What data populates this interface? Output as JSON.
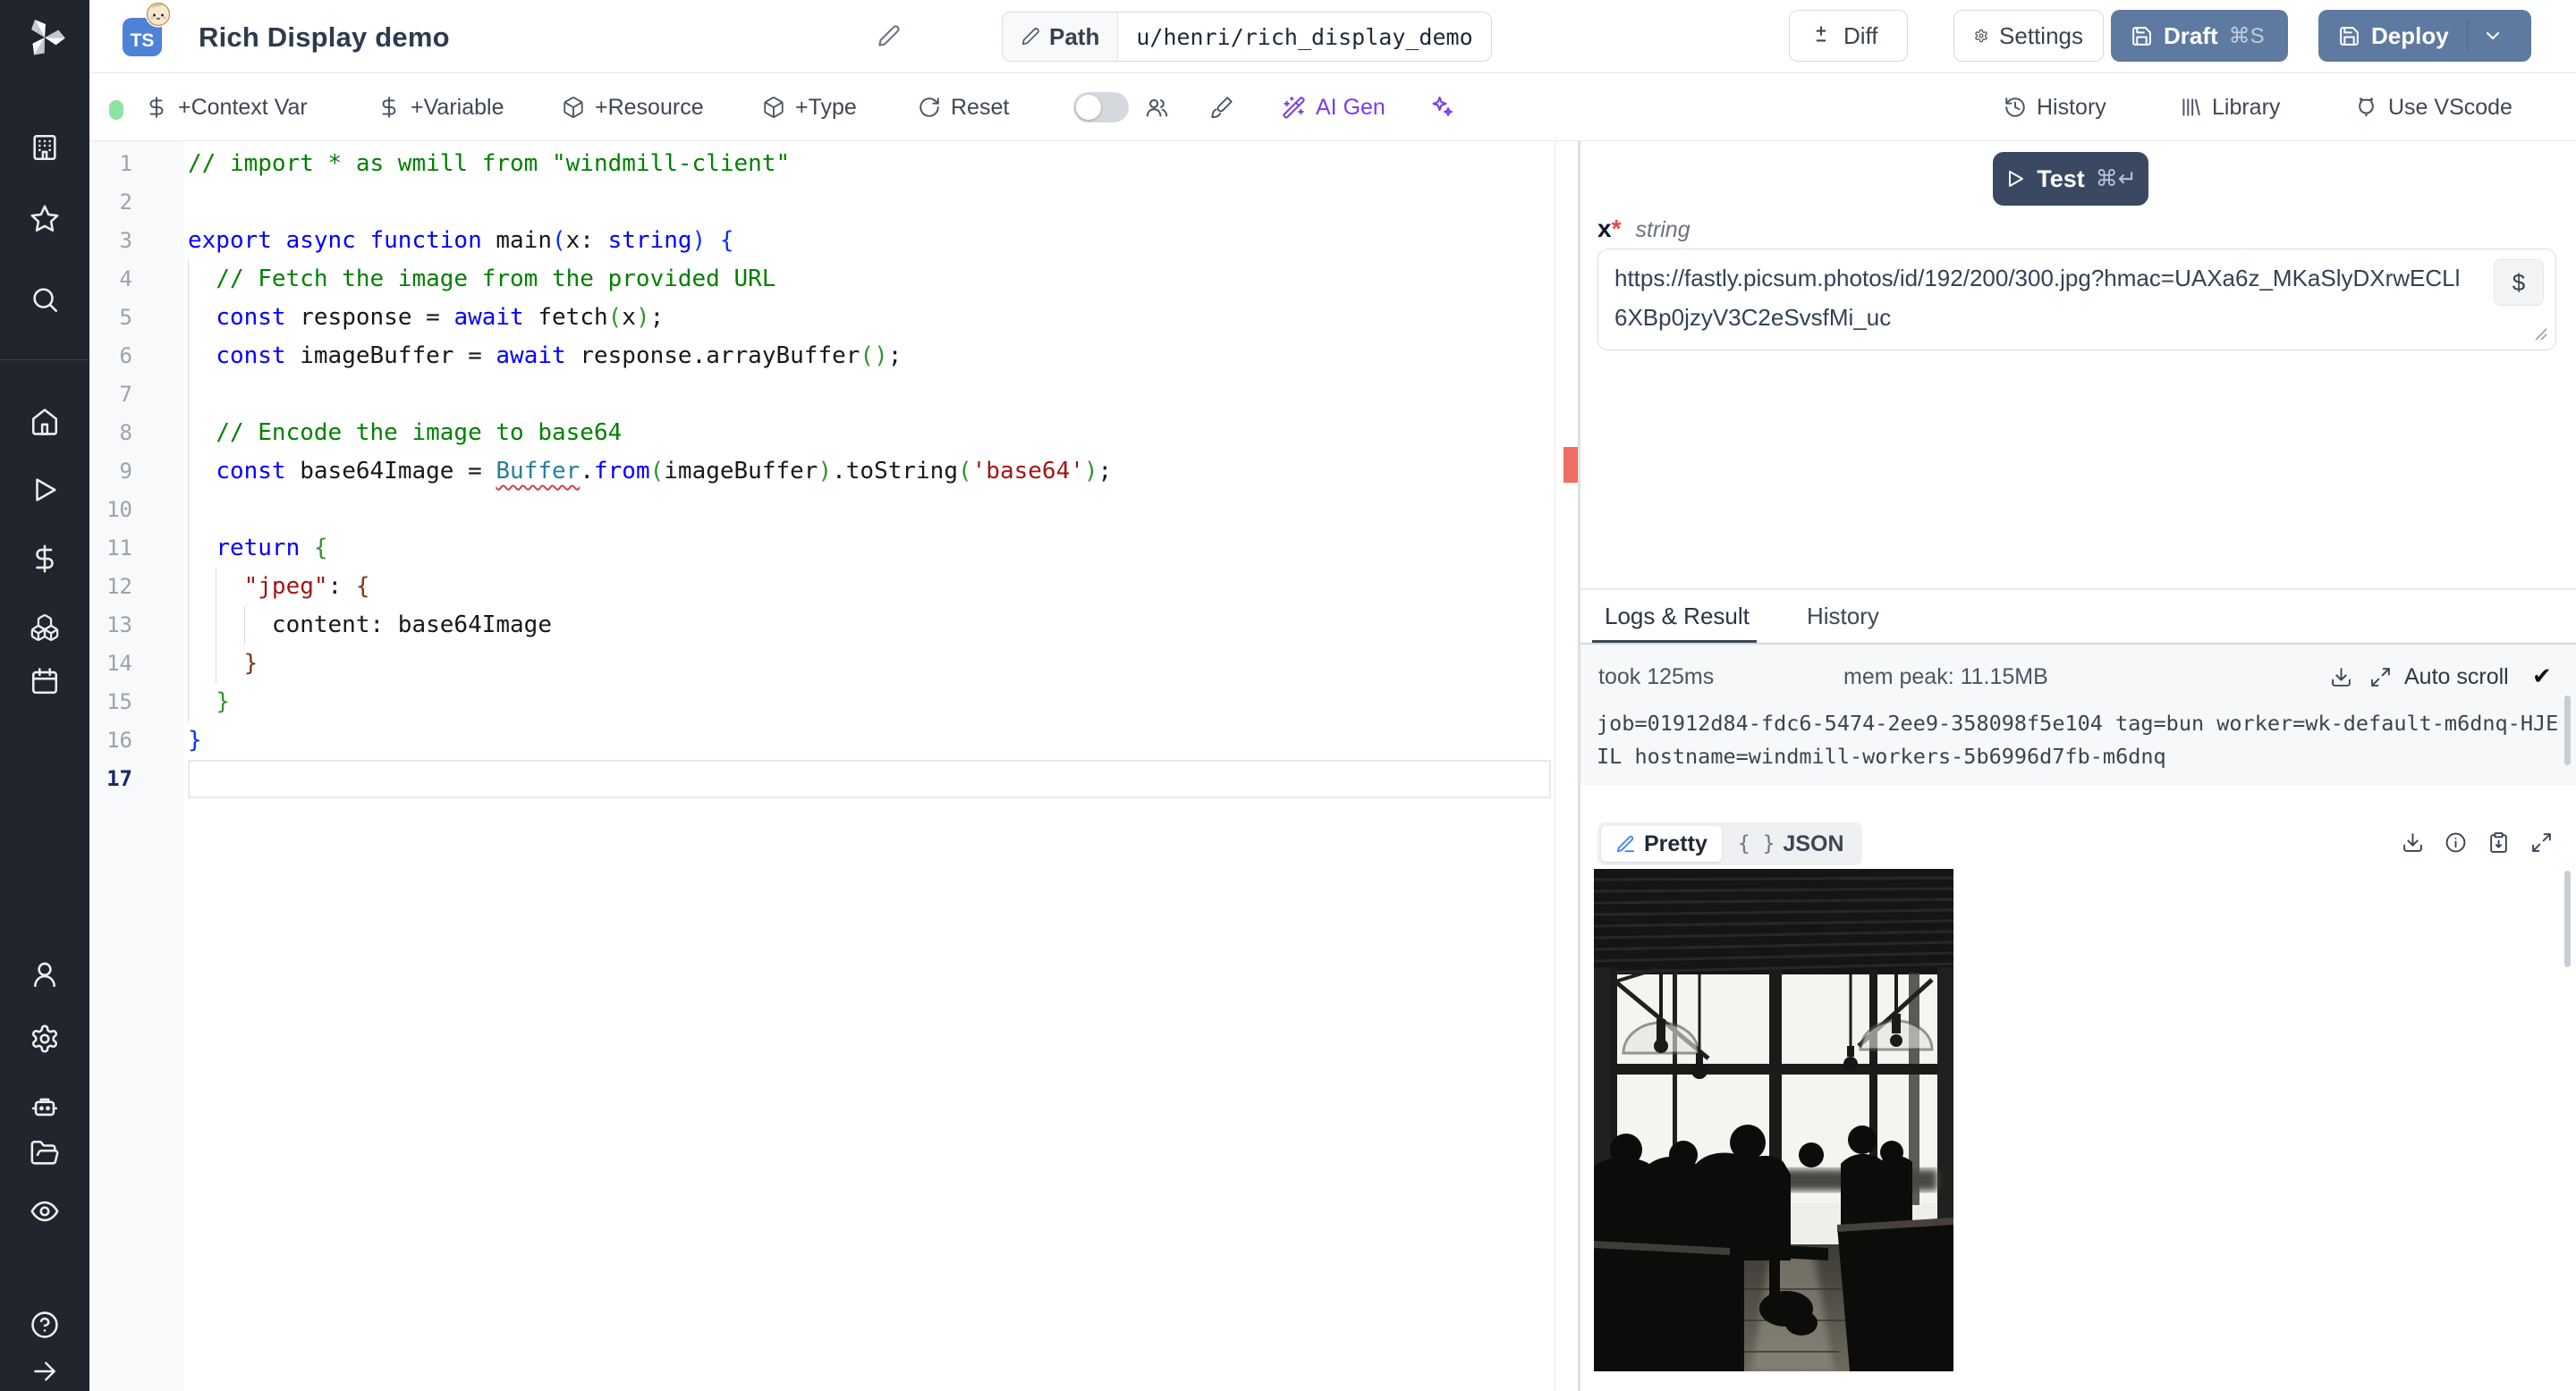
{
  "app": {
    "name": "Windmill"
  },
  "header": {
    "language_badge": "TS",
    "title": "Rich Display demo",
    "path_label": "Path",
    "path_value": "u/henri/rich_display_demo",
    "diff_label": "Diff",
    "settings_label": "Settings",
    "draft_label": "Draft",
    "draft_shortcut": "⌘S",
    "deploy_label": "Deploy"
  },
  "toolbar": {
    "context_var": "+Context Var",
    "variable": "+Variable",
    "resource": "+Resource",
    "type": "+Type",
    "reset": "Reset",
    "ai_gen": "AI Gen",
    "history": "History",
    "library": "Library",
    "vscode": "Use VScode",
    "accent_purple": "#7c3aed",
    "status_green": "#8fe3a2"
  },
  "sidebar": {
    "icons": [
      "windmill-logo",
      "workspace",
      "favorites",
      "search",
      "home",
      "runs",
      "variables",
      "resources",
      "schedules",
      "user",
      "settings",
      "workers",
      "folders",
      "audit-logs",
      "help",
      "expand"
    ]
  },
  "editor": {
    "active_line": 17,
    "error_line": 9,
    "colors": {
      "comment": "#008000",
      "keyword": "#0000ff",
      "type": "#267f99",
      "string": "#a31515"
    },
    "lines": [
      {
        "n": 1,
        "g": [],
        "seg": [
          [
            "c",
            "// import * as wmill from \"windmill-client\""
          ]
        ]
      },
      {
        "n": 2,
        "g": [],
        "seg": []
      },
      {
        "n": 3,
        "g": [],
        "seg": [
          [
            "k",
            "export async function "
          ],
          [
            "p",
            "main"
          ],
          [
            "b1",
            "("
          ],
          [
            "p",
            "x: "
          ],
          [
            "k",
            "string"
          ],
          [
            "b1",
            ")"
          ],
          [
            "p",
            " "
          ],
          [
            "b1",
            "{"
          ]
        ]
      },
      {
        "n": 4,
        "g": [
          0
        ],
        "seg": [
          [
            "p",
            "  "
          ],
          [
            "c",
            "// Fetch the image from the provided URL"
          ]
        ]
      },
      {
        "n": 5,
        "g": [
          0
        ],
        "seg": [
          [
            "p",
            "  "
          ],
          [
            "k",
            "const"
          ],
          [
            "p",
            " response = "
          ],
          [
            "k",
            "await"
          ],
          [
            "p",
            " fetch"
          ],
          [
            "b2",
            "("
          ],
          [
            "p",
            "x"
          ],
          [
            "b2",
            ")"
          ],
          [
            "p",
            ";"
          ]
        ]
      },
      {
        "n": 6,
        "g": [
          0
        ],
        "seg": [
          [
            "p",
            "  "
          ],
          [
            "k",
            "const"
          ],
          [
            "p",
            " imageBuffer = "
          ],
          [
            "k",
            "await"
          ],
          [
            "p",
            " response.arrayBuffer"
          ],
          [
            "b2",
            "()"
          ],
          [
            "p",
            ";"
          ]
        ]
      },
      {
        "n": 7,
        "g": [
          0
        ],
        "seg": []
      },
      {
        "n": 8,
        "g": [
          0
        ],
        "seg": [
          [
            "p",
            "  "
          ],
          [
            "c",
            "// Encode the image to base64"
          ]
        ]
      },
      {
        "n": 9,
        "g": [
          0
        ],
        "seg": [
          [
            "p",
            "  "
          ],
          [
            "k",
            "const"
          ],
          [
            "p",
            " base64Image = "
          ],
          [
            "terr",
            "Buffer"
          ],
          [
            "p",
            "."
          ],
          [
            "k",
            "from"
          ],
          [
            "b2",
            "("
          ],
          [
            "p",
            "imageBuffer"
          ],
          [
            "b2",
            ")"
          ],
          [
            "p",
            ".toString"
          ],
          [
            "b2",
            "("
          ],
          [
            "s",
            "'base64'"
          ],
          [
            "b2",
            ")"
          ],
          [
            "p",
            ";"
          ]
        ]
      },
      {
        "n": 10,
        "g": [
          0
        ],
        "seg": []
      },
      {
        "n": 11,
        "g": [
          0
        ],
        "seg": [
          [
            "p",
            "  "
          ],
          [
            "k",
            "return"
          ],
          [
            "p",
            " "
          ],
          [
            "b2",
            "{"
          ]
        ]
      },
      {
        "n": 12,
        "g": [
          0,
          2
        ],
        "seg": [
          [
            "p",
            "    "
          ],
          [
            "s",
            "\"jpeg\""
          ],
          [
            "p",
            ": "
          ],
          [
            "b3",
            "{"
          ]
        ]
      },
      {
        "n": 13,
        "g": [
          0,
          2,
          4
        ],
        "seg": [
          [
            "p",
            "      content: base64Image"
          ]
        ]
      },
      {
        "n": 14,
        "g": [
          0,
          2
        ],
        "seg": [
          [
            "p",
            "    "
          ],
          [
            "b3",
            "}"
          ]
        ]
      },
      {
        "n": 15,
        "g": [
          0
        ],
        "seg": [
          [
            "p",
            "  "
          ],
          [
            "b2",
            "}"
          ]
        ]
      },
      {
        "n": 16,
        "g": [],
        "seg": [
          [
            "b1",
            "}"
          ]
        ]
      },
      {
        "n": 17,
        "g": [],
        "seg": [],
        "active": true
      }
    ]
  },
  "run_panel": {
    "test_label": "Test",
    "test_shortcut": "⌘↵",
    "arg_name": "x",
    "arg_required": "*",
    "arg_type": "string",
    "arg_value": "https://fastly.picsum.photos/id/192/200/300.jpg?hmac=UAXa6z_MKaSlyDXrwECLl6XBp0jzyV3C2eSvsfMi_uc",
    "var_picker_label": "$",
    "tabs": {
      "logs": "Logs & Result",
      "history": "History"
    },
    "stats": {
      "took": "took 125ms",
      "mem": "mem peak: 11.15MB",
      "autoscroll": "Auto scroll",
      "check": "✔"
    },
    "log_text": "job=01912d84-fdc6-5474-2ee9-358098f5e104 tag=bun worker=wk-default-m6dnq-HJEIL hostname=windmill-workers-5b6996d7fb-m6dnq",
    "result": {
      "pretty_label": "Pretty",
      "json_label": "JSON",
      "json_icon": "{ }",
      "image_desc": "black and white cafe interior, bright windows, silhouetted people at tables"
    }
  }
}
